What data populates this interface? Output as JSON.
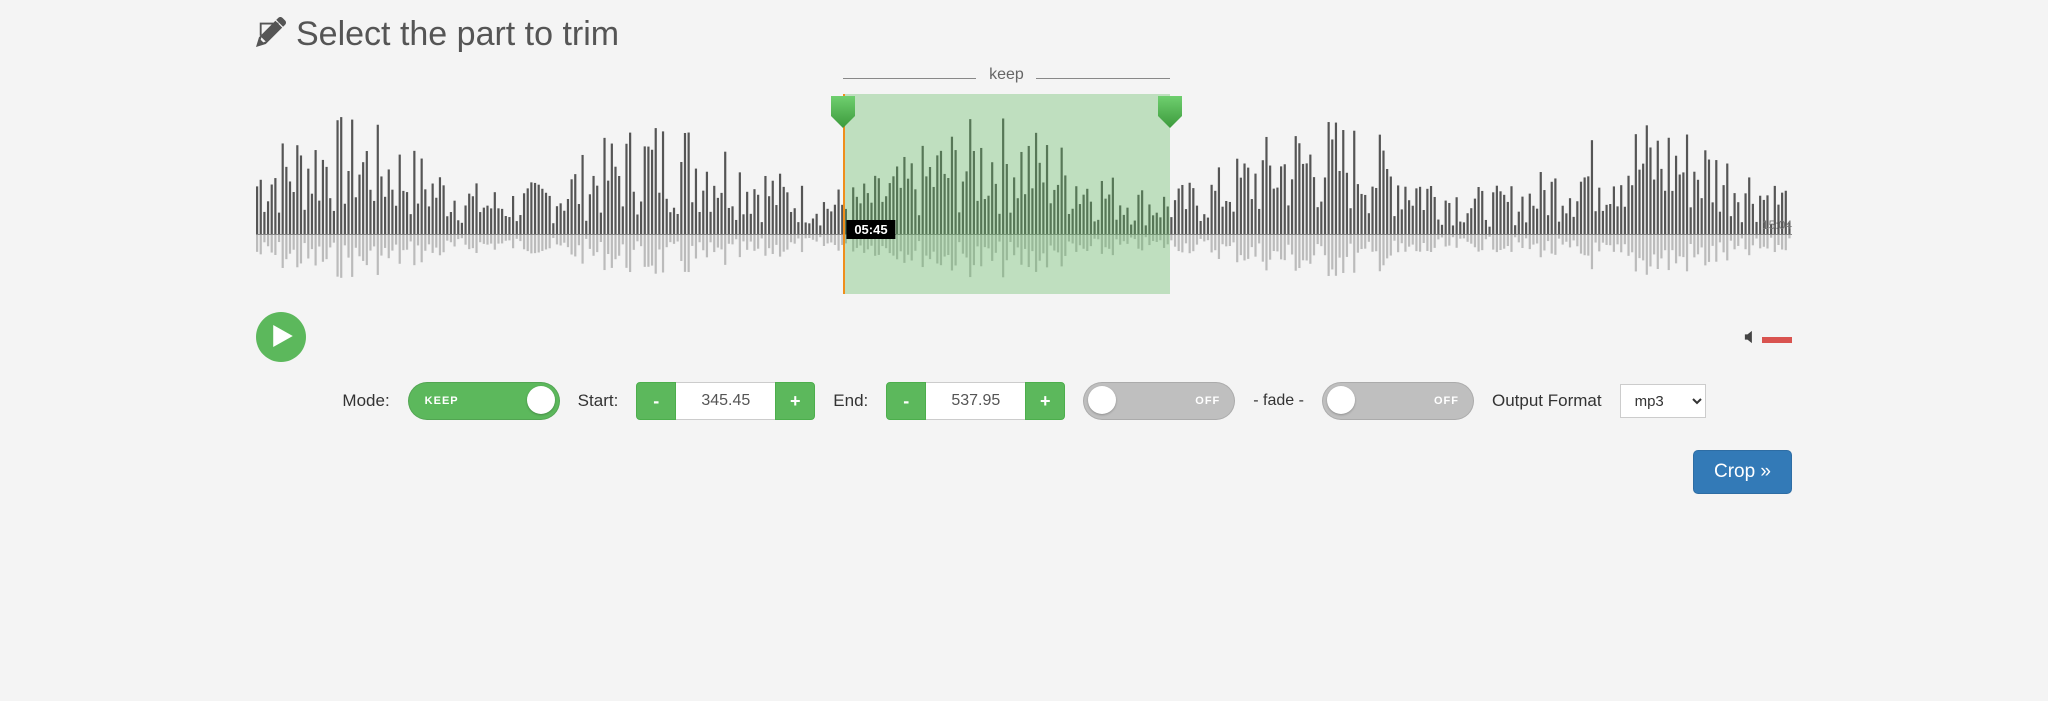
{
  "title": "Select the part to trim",
  "brace_label": "keep",
  "waveform": {
    "playhead_time": "05:45",
    "total_time": "15:04",
    "total_seconds": 904,
    "selection_start_sec": 345.45,
    "selection_end_sec": 537.95
  },
  "controls": {
    "mode_label": "Mode:",
    "mode_value": "KEEP",
    "start_label": "Start:",
    "start_value": "345.45",
    "end_label": "End:",
    "end_value": "537.95",
    "minus": "-",
    "plus": "+",
    "fade_sep": "- fade -",
    "fade_in_value": "OFF",
    "fade_out_value": "OFF",
    "format_label": "Output Format",
    "format_value": "mp3",
    "crop_label": "Crop »"
  }
}
